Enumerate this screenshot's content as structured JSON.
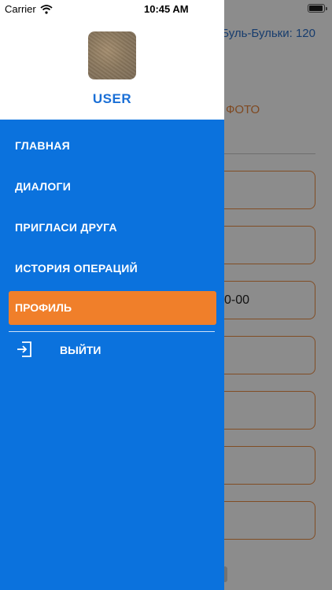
{
  "status_bar": {
    "carrier": "Carrier",
    "time": "10:45 AM"
  },
  "background": {
    "balance_text": "Буль-Бульки: 120",
    "photo_link": "ь ФОТО",
    "fields": [
      "",
      "",
      "0-00",
      "",
      "",
      "",
      ""
    ]
  },
  "drawer": {
    "username": "USER",
    "menu": [
      {
        "label": "ГЛАВНАЯ"
      },
      {
        "label": "ДИАЛОГИ"
      },
      {
        "label": "ПРИГЛАСИ ДРУГА"
      },
      {
        "label": "ИСТОРИЯ ОПЕРАЦИЙ"
      },
      {
        "label": "ПРОФИЛЬ"
      }
    ],
    "logout_label": "ВЫЙТИ",
    "logout_icon": "logout-icon"
  },
  "colors": {
    "drawer_bg": "#0b72dd",
    "active_item": "#f07f2a",
    "username": "#1a6fd6",
    "field_border": "#ec8c43"
  }
}
